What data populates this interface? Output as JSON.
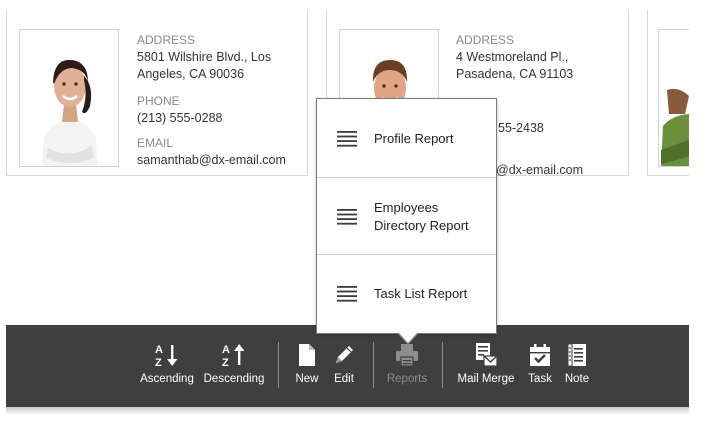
{
  "cards": [
    {
      "address_label": "ADDRESS",
      "address_line1": "5801 Wilshire Blvd., Los",
      "address_line2": "Angeles, CA 90036",
      "phone_label": "PHONE",
      "phone": "(213) 555-0288",
      "email_label": "EMAIL",
      "email": "samanthab@dx-email.com"
    },
    {
      "address_label": "ADDRESS",
      "address_line1": "4 Westmoreland Pl.,",
      "address_line2": "Pasadena, CA 91103",
      "phone_partial": "55-2438",
      "email_partial": "@dx-email.com"
    }
  ],
  "reports_menu": {
    "items": [
      {
        "label_line1": "Profile Report",
        "label_line2": ""
      },
      {
        "label_line1": "Employees",
        "label_line2": "Directory Report"
      },
      {
        "label_line1": "Task List Report",
        "label_line2": ""
      }
    ],
    "icon": "report-lines-icon"
  },
  "toolbar": {
    "ascending": "Ascending",
    "descending": "Descending",
    "new": "New",
    "edit": "Edit",
    "reports": "Reports",
    "mail_merge": "Mail Merge",
    "task": "Task",
    "note": "Note"
  },
  "colors": {
    "toolbar_bg": "#3f3f3f",
    "disabled_text": "#8e8e8e",
    "label_text": "#8a8a8a"
  }
}
